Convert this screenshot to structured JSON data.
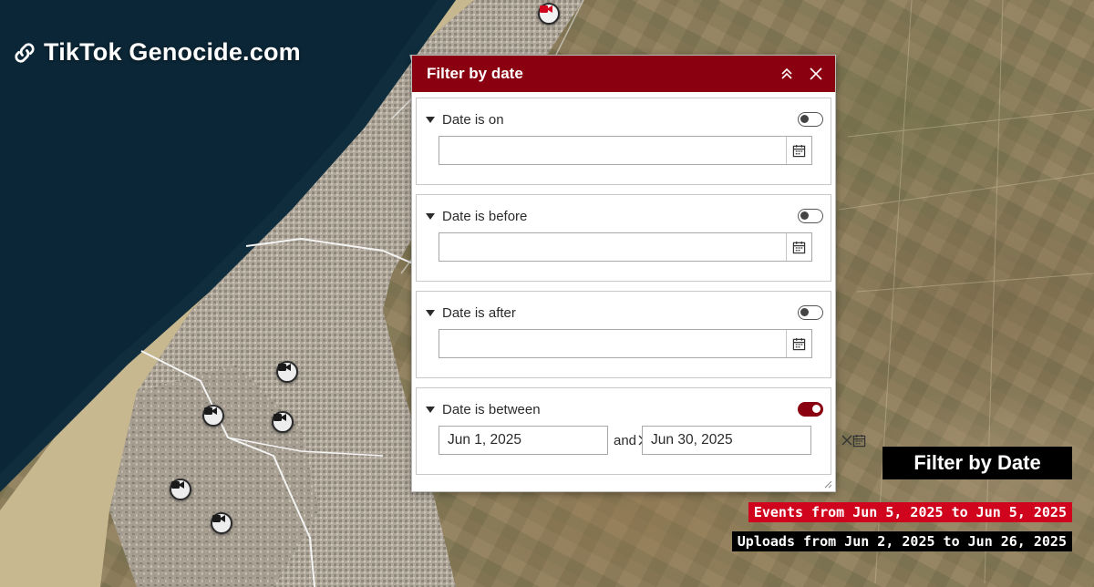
{
  "brand": {
    "text": "TikTok Genocide.com"
  },
  "panel": {
    "title": "Filter by date",
    "sections": [
      {
        "label": "Date is on",
        "enabled": false,
        "value": ""
      },
      {
        "label": "Date is before",
        "enabled": false,
        "value": ""
      },
      {
        "label": "Date is after",
        "enabled": false,
        "value": ""
      },
      {
        "label": "Date is between",
        "enabled": true,
        "start": "Jun 1, 2025",
        "connector": "and",
        "end": "Jun 30, 2025"
      }
    ]
  },
  "overlay": {
    "heading": "Filter by Date",
    "events": "Events from Jun 5, 2025 to Jun 5, 2025",
    "uploads": "Uploads from Jun 2, 2025 to Jun 26, 2025"
  },
  "colors": {
    "header": "#8a0010",
    "events_bg": "#d0041c",
    "sea": "#0f2d3d",
    "toggle_on": "#8a0010"
  },
  "icons": {
    "brand": "link-icon",
    "collapse": "chevron-double-up-icon",
    "close": "close-icon",
    "calendar": "calendar-icon",
    "clear": "clear-icon",
    "marker": "video-camera-icon"
  }
}
